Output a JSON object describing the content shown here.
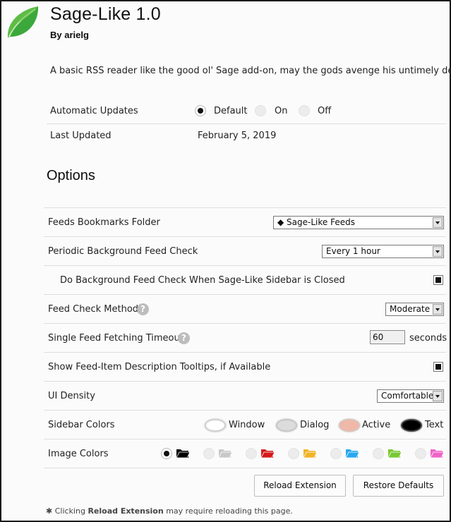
{
  "header": {
    "title": "Sage-Like",
    "version": "1.0",
    "author": "By arielg",
    "description": "A basic RSS reader like the good ol' Sage add-on, may the gods avenge his untimely death."
  },
  "details": {
    "automatic_updates_label": "Automatic Updates",
    "update_options": [
      "Default",
      "On",
      "Off"
    ],
    "selected_update_option": "Default",
    "last_updated_label": "Last Updated",
    "last_updated_value": "February 5, 2019"
  },
  "options": {
    "heading": "Options",
    "bookmarks_folder_label": "Feeds Bookmarks Folder",
    "bookmarks_folder_value": "◆ Sage-Like Feeds",
    "periodic_check_label": "Periodic Background Feed Check",
    "periodic_check_value": "Every 1 hour",
    "background_check_closed_label": "Do Background Feed Check When Sage-Like Sidebar is Closed",
    "background_check_closed_checked": true,
    "feed_check_method_label": "Feed Check Method",
    "feed_check_method_value": "Moderate",
    "timeout_label": "Single Feed Fetching Timeout",
    "timeout_value": "60",
    "timeout_unit": "seconds",
    "tooltips_label": "Show Feed-Item Description Tooltips, if Available",
    "tooltips_checked": true,
    "ui_density_label": "UI Density",
    "ui_density_value": "Comfortable",
    "sidebar_colors_label": "Sidebar Colors",
    "sidebar_colors": [
      {
        "label": "Window",
        "color": "#ffffff"
      },
      {
        "label": "Dialog",
        "color": "#dcdcdc"
      },
      {
        "label": "Active",
        "color": "#f0b8a8"
      },
      {
        "label": "Text",
        "color": "#000000"
      }
    ],
    "image_colors_label": "Image Colors",
    "image_colors": [
      "#000000",
      "#c8c8c8",
      "#d41a1a",
      "#f0b428",
      "#28a8f0",
      "#78c832",
      "#f064c8"
    ],
    "selected_image_color_index": 0,
    "reload_button": "Reload Extension",
    "restore_button": "Restore Defaults",
    "footnote_prefix": "✱ Clicking",
    "footnote_bold": "Reload Extension",
    "footnote_suffix": "may require reloading this page."
  },
  "colors": {
    "accent": "#111111",
    "divider": "#dedede"
  }
}
